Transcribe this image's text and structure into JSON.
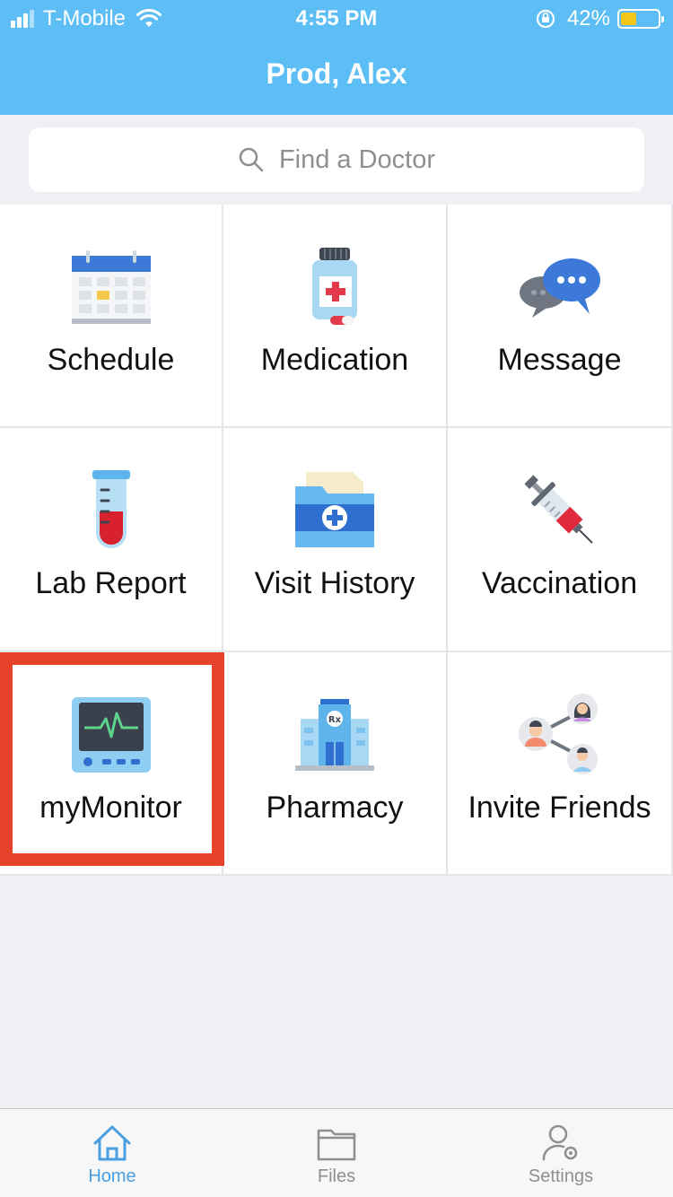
{
  "status": {
    "carrier": "T-Mobile",
    "time": "4:55 PM",
    "battery_percent": "42%",
    "battery_level": 0.42
  },
  "header": {
    "title": "Prod, Alex"
  },
  "search": {
    "placeholder": "Find a Doctor"
  },
  "tiles": [
    {
      "label": "Schedule",
      "icon": "calendar-icon"
    },
    {
      "label": "Medication",
      "icon": "medicine-bottle-icon"
    },
    {
      "label": "Message",
      "icon": "chat-bubbles-icon"
    },
    {
      "label": "Lab Report",
      "icon": "test-tube-icon"
    },
    {
      "label": "Visit History",
      "icon": "medical-folder-icon"
    },
    {
      "label": "Vaccination",
      "icon": "syringe-icon"
    },
    {
      "label": "myMonitor",
      "icon": "heart-monitor-icon",
      "highlighted": true
    },
    {
      "label": "Pharmacy",
      "icon": "pharmacy-building-icon"
    },
    {
      "label": "Invite Friends",
      "icon": "people-network-icon"
    }
  ],
  "tabbar": {
    "items": [
      {
        "label": "Home",
        "icon": "home-icon",
        "active": true
      },
      {
        "label": "Files",
        "icon": "folder-icon",
        "active": false
      },
      {
        "label": "Settings",
        "icon": "user-settings-icon",
        "active": false
      }
    ]
  },
  "colors": {
    "header": "#5cbef5",
    "highlight": "#e8422a",
    "active_tab": "#4a9fe0"
  }
}
